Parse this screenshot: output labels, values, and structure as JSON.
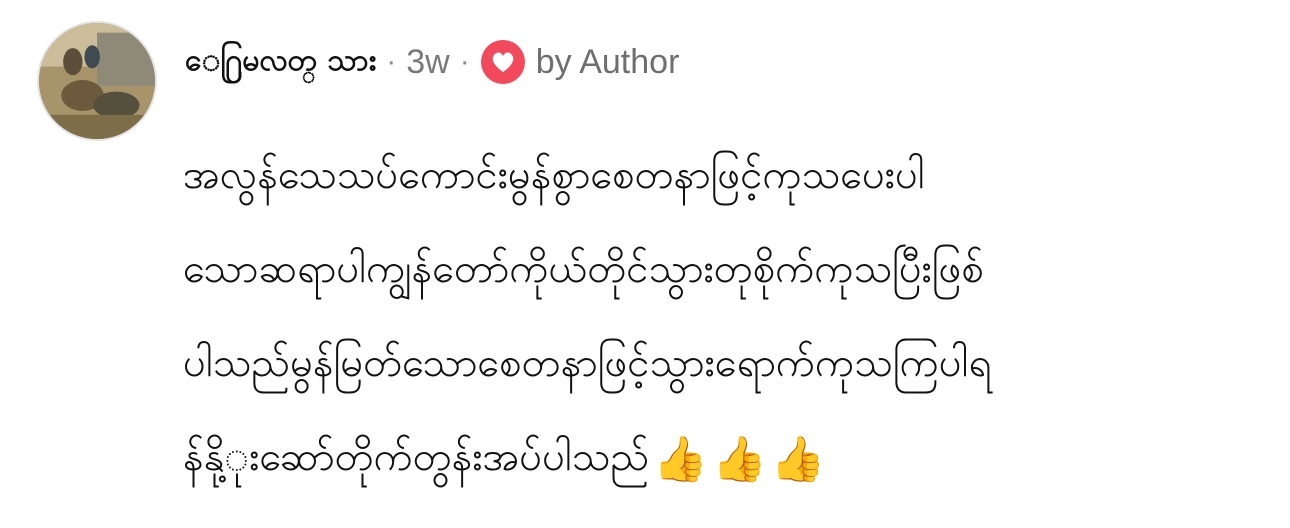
{
  "comment": {
    "author": "ေ႐ြမလတ္ သား",
    "separator_1": "·",
    "timestamp": "3w",
    "separator_2": "·",
    "heart_icon": "heart-icon",
    "heart_color": "#f2495c",
    "by_author": "by Author",
    "body_lines": [
      "အလွန်သေသပ်ကောင်းမွန်စွာစေတနာဖြင့်ကုသပေးပါ",
      "သောဆရာပါကျွန်တော်ကိုယ်တိုင်သွားတုစိုက်ကုသပြီးဖြစ်",
      "ပါသည်မွန်မြတ်သောစေတနာဖြင့်သွားရောက်ကုသကြပါရ",
      "န်နို့ုးဆော်တိုက်တွန်းအပ်ပါသည်"
    ],
    "emoji": [
      "👍",
      "👍",
      "👍"
    ],
    "emoji_name": "thumbs-up-icon"
  },
  "colors": {
    "text_primary": "#111111",
    "text_secondary": "#7a7a7a",
    "background": "#ffffff"
  }
}
